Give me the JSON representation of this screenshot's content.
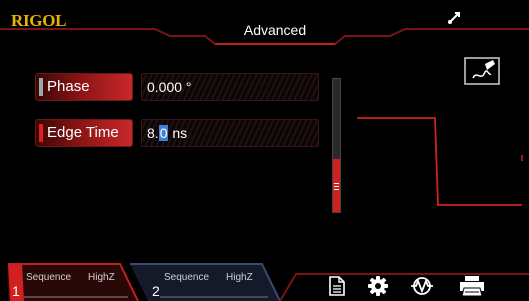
{
  "header": {
    "logo": "RIGOL",
    "title": "Advanced"
  },
  "params": [
    {
      "label": "Phase",
      "value": "0.000 °",
      "selected": false
    },
    {
      "label": "Edge Time",
      "value_before_cursor": "8.",
      "value_cursor": "0",
      "value_after_cursor": " ns",
      "selected": true
    }
  ],
  "channels": [
    {
      "number": "1",
      "mode": "Sequence",
      "impedance": "HighZ",
      "active": true
    },
    {
      "number": "2",
      "mode": "Sequence",
      "impedance": "HighZ",
      "active": false
    }
  ],
  "toolbar": {
    "icons": [
      "file-icon",
      "gear-icon",
      "waveform-icon",
      "printer-icon"
    ]
  },
  "status_icons": [
    "usb-icon",
    "edit-touch-icon"
  ],
  "colors": {
    "accent": "#d02020",
    "logo": "#e8b400",
    "background": "#000000"
  }
}
